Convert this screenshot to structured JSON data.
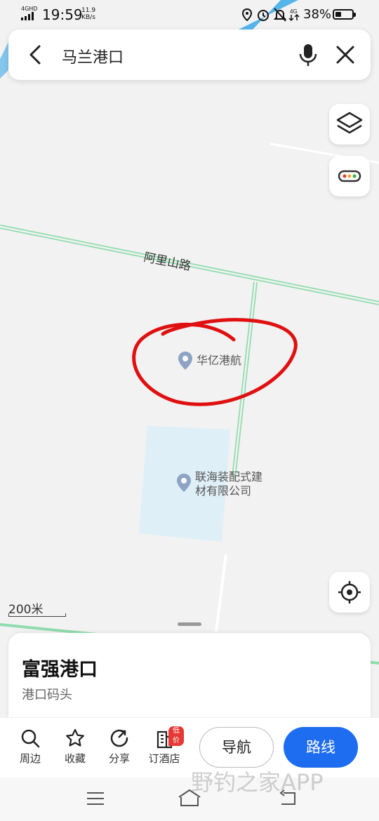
{
  "status_bar": {
    "network": "4GHD",
    "time": "19:59",
    "speed_value": "11.9",
    "speed_unit": "KB/s",
    "battery_text": "38%",
    "battery_level": 0.38
  },
  "search": {
    "query": "马兰港口"
  },
  "map": {
    "road_label": "阿里山路",
    "poi_1": "华亿港航",
    "poi_2_line1": "联海装配式建",
    "poi_2_line2": "材有限公司",
    "scale_label": "200米",
    "annotation_color": "#e01010",
    "road_color": "#8fdcae",
    "water_color": "#3aa9e8"
  },
  "place_card": {
    "title": "富强港口",
    "subtitle": "港口码头"
  },
  "actions": {
    "nearby": "周边",
    "favorite": "收藏",
    "share": "分享",
    "hotel": "订酒店",
    "hotel_badge": "低价",
    "navigate": "导航",
    "route": "路线"
  },
  "watermark": "野钓之家APP",
  "accent_color": "#1e6cf0"
}
